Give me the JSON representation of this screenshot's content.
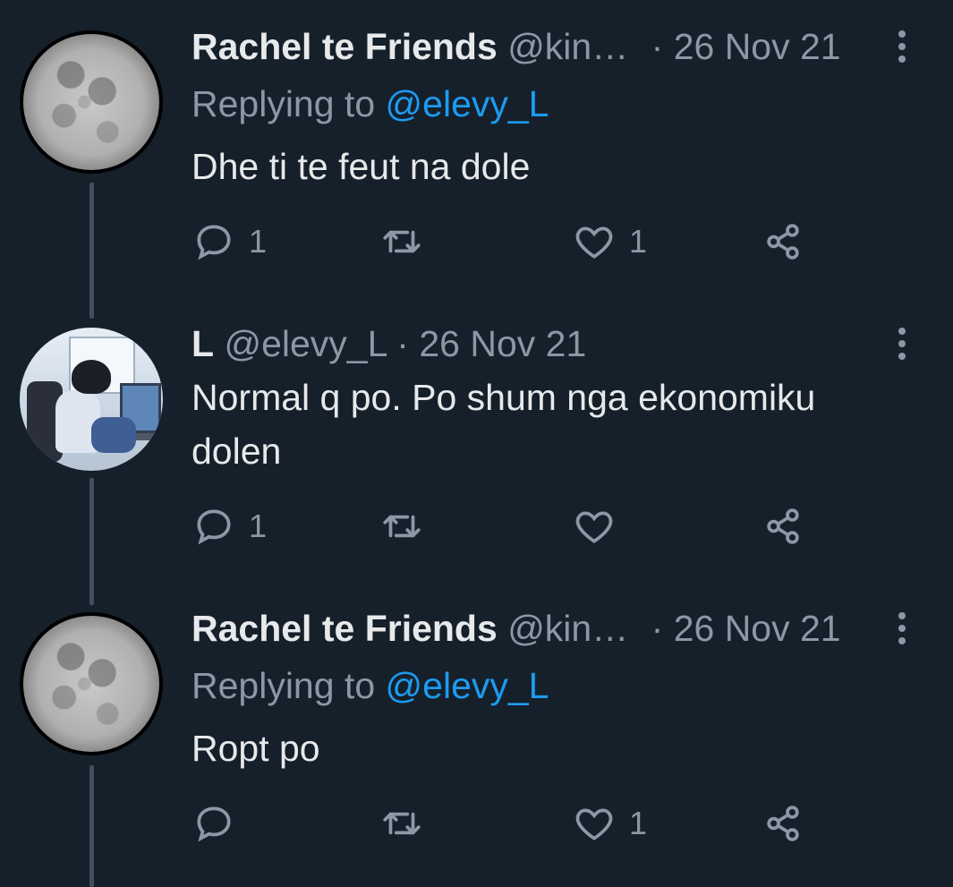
{
  "tweets": [
    {
      "author_name": "Rachel te Friends",
      "handle": "@kin…",
      "separator": "·",
      "date": "26 Nov 21",
      "replying_label": "Replying to",
      "replying_to": "@elevy_L",
      "text": "Dhe ti te feut na dole",
      "reply_count": "1",
      "like_count": "1",
      "avatar_icon": "moon-avatar"
    },
    {
      "author_name": "L",
      "handle": "@elevy_L",
      "separator": "·",
      "date": "26 Nov 21",
      "text": "Normal q po. Po shum nga ekonomiku dolen",
      "reply_count": "1",
      "like_count": "",
      "avatar_icon": "anime-avatar"
    },
    {
      "author_name": "Rachel te Friends",
      "handle": "@kin…",
      "separator": "·",
      "date": "26 Nov 21",
      "replying_label": "Replying to",
      "replying_to": "@elevy_L",
      "text": "Ropt po",
      "reply_count": "",
      "like_count": "1",
      "avatar_icon": "moon-avatar"
    }
  ],
  "colors": {
    "background": "#15202b",
    "primary_text": "#e7e9ea",
    "secondary_text": "#8b98a5",
    "accent": "#1d9bf0",
    "thread_line": "#3f5060"
  },
  "icons": [
    "reply-icon",
    "retweet-icon",
    "like-icon",
    "share-icon",
    "more-icon"
  ]
}
